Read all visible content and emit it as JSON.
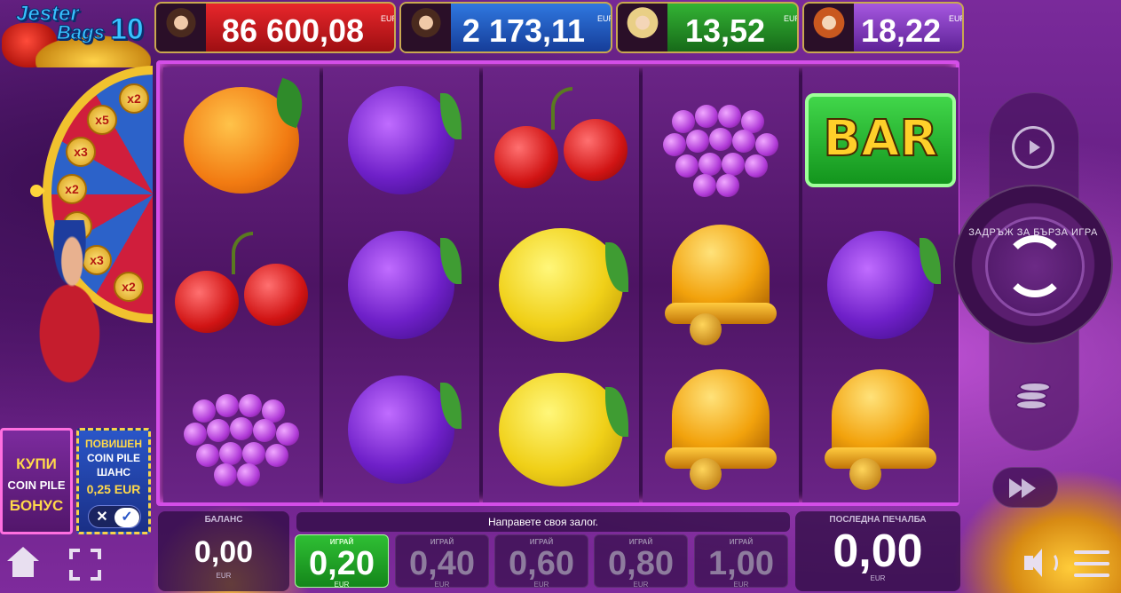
{
  "game": {
    "logo_line1": "Jester",
    "logo_line2": "Bags",
    "logo_number": "10"
  },
  "jackpots": [
    {
      "value": "86 600,08",
      "currency": "EUR",
      "color": "#d6191f"
    },
    {
      "value": "2 173,11",
      "currency": "EUR",
      "color": "#2660c9"
    },
    {
      "value": "13,52",
      "currency": "EUR",
      "color": "#25a024"
    },
    {
      "value": "18,22",
      "currency": "EUR",
      "color": "#8a3fcb"
    }
  ],
  "wheel": {
    "multipliers": [
      "x2",
      "x5",
      "x3",
      "x2",
      "x5",
      "x3",
      "x2"
    ]
  },
  "bonus": {
    "buy_line1": "КУПИ",
    "buy_line2": "COIN PILE",
    "buy_line3": "БОНУС",
    "chance_line1": "ПОВИШЕН",
    "chance_line2": "COIN PILE",
    "chance_line3": "ШАНС",
    "chance_price": "0,25 EUR",
    "toggle_off": "✕",
    "toggle_on": "✓"
  },
  "reels": [
    [
      "orange",
      "cherry",
      "grapes"
    ],
    [
      "plum",
      "plum",
      "plum"
    ],
    [
      "cherry",
      "lemon",
      "lemon"
    ],
    [
      "grapes",
      "bell",
      "bell"
    ],
    [
      "bar",
      "plum",
      "bell"
    ]
  ],
  "bar_symbol_text": "BAR",
  "controls": {
    "spin_caption": "ЗАДРЪЖ ЗА БЪРЗА ИГРА"
  },
  "balance": {
    "label": "БАЛАНС",
    "value": "0,00",
    "currency": "EUR"
  },
  "message": "Направете своя залог.",
  "bets": [
    {
      "label": "ИГРАЙ",
      "value": "0,20",
      "currency": "EUR",
      "active": true
    },
    {
      "label": "ИГРАЙ",
      "value": "0,40",
      "currency": "EUR",
      "active": false
    },
    {
      "label": "ИГРАЙ",
      "value": "0,60",
      "currency": "EUR",
      "active": false
    },
    {
      "label": "ИГРАЙ",
      "value": "0,80",
      "currency": "EUR",
      "active": false
    },
    {
      "label": "ИГРАЙ",
      "value": "1,00",
      "currency": "EUR",
      "active": false
    }
  ],
  "last_win": {
    "label": "ПОСЛЕДНА ПЕЧАЛБА",
    "value": "0,00",
    "currency": "EUR"
  },
  "icons": {
    "home": "home-icon",
    "fullscreen": "fullscreen-icon",
    "sound": "sound-icon",
    "menu": "menu-icon",
    "autoplay": "autoplay-icon",
    "spin": "spin-icon",
    "coins": "coins-icon",
    "turbo": "turbo-icon"
  }
}
